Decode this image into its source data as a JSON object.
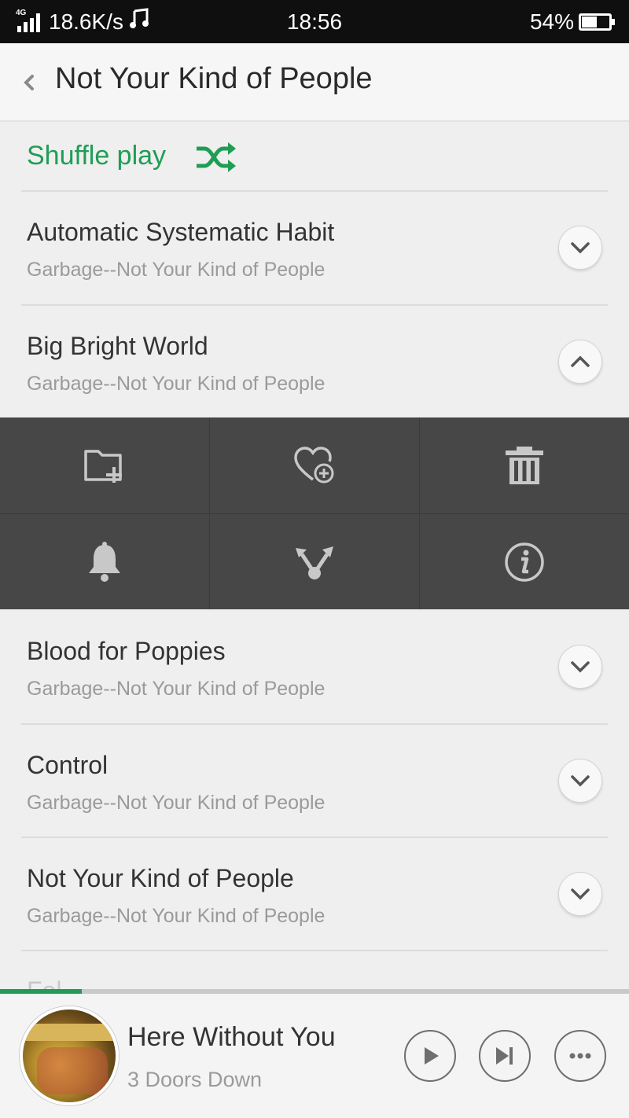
{
  "status_bar": {
    "network_tag": "4G",
    "speed": "18.6K/s",
    "time": "18:56",
    "battery": "54%",
    "battery_level": 0.54
  },
  "header": {
    "title": "Not Your Kind of People"
  },
  "shuffle": {
    "label": "Shuffle play"
  },
  "songs": [
    {
      "title": "Automatic Systematic Habit",
      "subtitle": "Garbage--Not Your Kind of People",
      "expanded": false
    },
    {
      "title": "Big Bright World",
      "subtitle": "Garbage--Not Your Kind of People",
      "expanded": true
    },
    {
      "title": "Blood for Poppies",
      "subtitle": "Garbage--Not Your Kind of People",
      "expanded": false
    },
    {
      "title": "Control",
      "subtitle": "Garbage--Not Your Kind of People",
      "expanded": false
    },
    {
      "title": "Not Your Kind of People",
      "subtitle": "Garbage--Not Your Kind of People",
      "expanded": false
    }
  ],
  "peek_row": {
    "title": "Fol..."
  },
  "actions": {
    "icons": [
      "add-to-folder-icon",
      "add-to-favorites-icon",
      "delete-icon",
      "ringtone-bell-icon",
      "share-icon",
      "info-icon"
    ]
  },
  "progress": {
    "fraction": 0.13
  },
  "player": {
    "title": "Here Without You",
    "artist": "3 Doors Down"
  },
  "colors": {
    "accent": "#1f9d55",
    "action_panel": "#474747",
    "background": "#efefef"
  }
}
